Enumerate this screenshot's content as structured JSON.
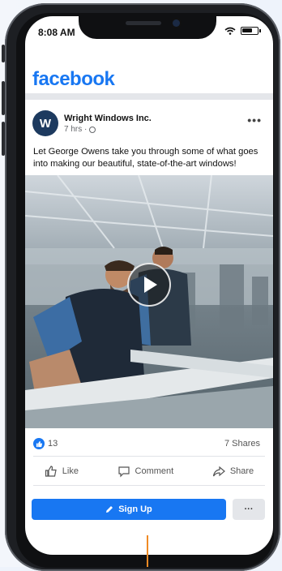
{
  "status_bar": {
    "time": "8:08 AM"
  },
  "app": {
    "logo_text": "facebook",
    "brand_color": "#1877f2"
  },
  "post": {
    "avatar_letter": "W",
    "page_name": "Wright Windows Inc.",
    "timestamp": "7 hrs ·",
    "text": "Let George Owens take you through some of what goes into making our beautiful, state-of-the-art windows!",
    "likes": "13",
    "shares": "7 Shares"
  },
  "actions": {
    "like": "Like",
    "comment": "Comment",
    "share": "Share"
  },
  "cta": {
    "signup": "Sign Up",
    "more": "···"
  },
  "icons": [
    "wifi-icon",
    "battery-icon",
    "globe-icon",
    "more-dots-icon",
    "play-icon",
    "thumbs-up-icon",
    "comment-icon",
    "share-icon",
    "pencil-icon"
  ]
}
